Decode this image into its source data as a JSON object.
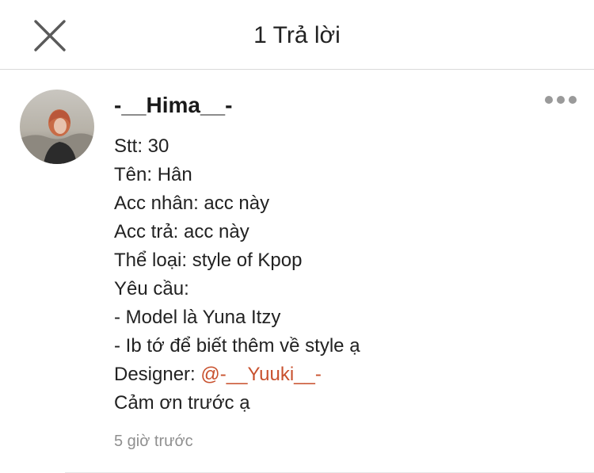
{
  "header": {
    "title": "1 Trả lời",
    "close_icon": "close-icon"
  },
  "comment": {
    "avatar_icon": "user-avatar",
    "username": "-__Hima__-",
    "more_icon": "more-horizontal-icon",
    "lines": [
      "Stt: 30",
      "Tên: Hân",
      "Acc nhân: acc này",
      "Acc trả: acc này",
      "Thể loại: style of Kpop",
      "Yêu cầu:",
      "- Model là Yuna Itzy",
      "- Ib tớ để biết thêm về style ạ"
    ],
    "designer_prefix": "Designer: ",
    "designer_mention": "@-__Yuuki__-",
    "closing_line": "Cảm ơn trước ạ",
    "timestamp": "5 giờ trước"
  },
  "colors": {
    "mention": "#c8512e",
    "timestamp": "#8f8f8f",
    "divider": "#d9d9d9"
  }
}
